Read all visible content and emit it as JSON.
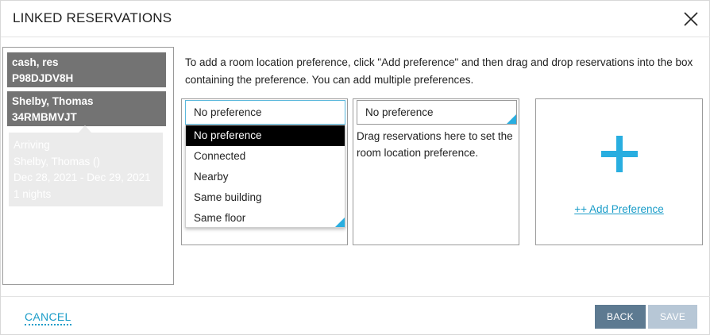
{
  "dialog": {
    "title": "LINKED RESERVATIONS",
    "close_icon": "close-icon"
  },
  "reservations": [
    {
      "name": "cash, res",
      "code": "P98DJDV8H"
    },
    {
      "name": "Shelby, Thomas",
      "code": "34RMBMVJT"
    }
  ],
  "tooltip": {
    "status": "Arriving",
    "guest": "Shelby, Thomas ()",
    "dates": "Dec 28, 2021 - Dec 29, 2021",
    "nights": "1 nights"
  },
  "instructions": "To add a room location preference, click \"Add preference\" and then drag and drop reservations into the box containing the preference. You can add multiple preferences.",
  "preference_boxes": [
    {
      "selected": "No preference"
    },
    {
      "selected": "No preference",
      "hint": "Drag reservations here to set the room location preference."
    }
  ],
  "dropdown_options": [
    "No preference",
    "Connected",
    "Nearby",
    "Same building",
    "Same floor"
  ],
  "add_preference": {
    "label": "++ Add Preference",
    "icon": "plus-icon"
  },
  "footer": {
    "cancel": "CANCEL",
    "back": "BACK",
    "save": "SAVE"
  },
  "colors": {
    "accent": "#29aee0",
    "link": "#1a9cc8",
    "card_bg": "#737373",
    "back_button": "#5d7a91",
    "save_button_disabled": "#b7c7d6"
  }
}
